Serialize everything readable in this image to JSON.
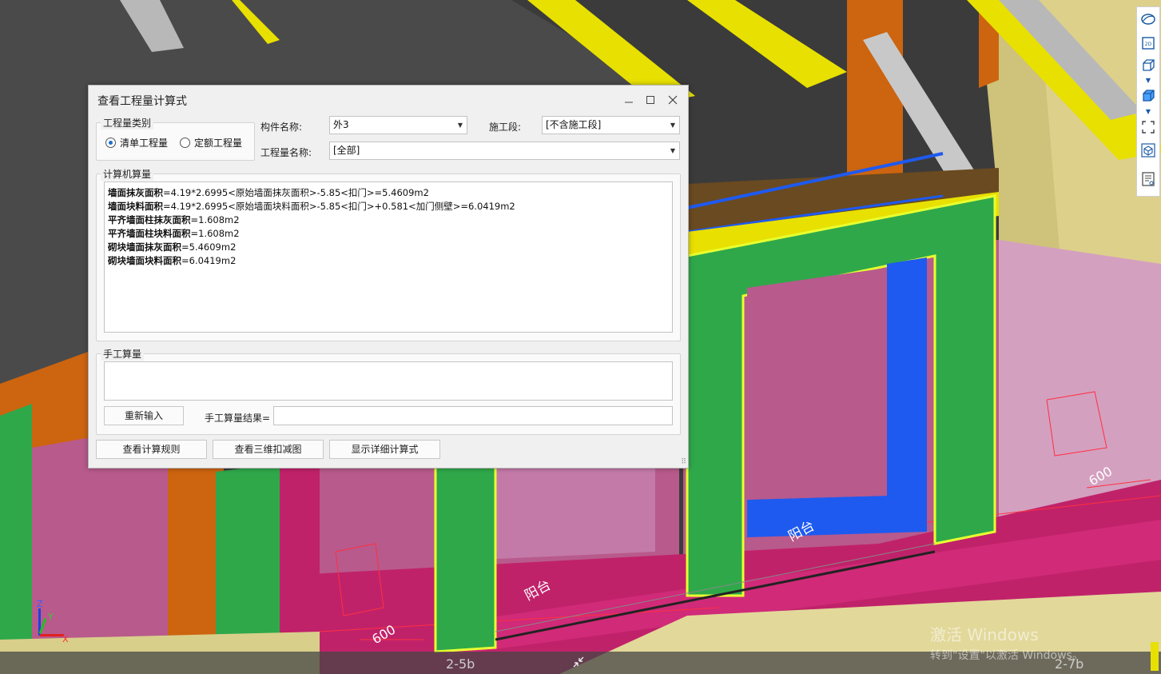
{
  "dialog": {
    "title": "查看工程量计算式",
    "quantity_type": {
      "legend": "工程量类别",
      "options": [
        "清单工程量",
        "定额工程量"
      ],
      "selected": "清单工程量"
    },
    "component_name": {
      "label": "构件名称:",
      "value": "外3"
    },
    "construction_stage": {
      "label": "施工段:",
      "value": "[不含施工段]"
    },
    "quantity_name": {
      "label": "工程量名称:",
      "value": "[全部]"
    },
    "computer_calc": {
      "legend": "计算机算量",
      "lines": [
        {
          "name": "墙面抹灰面积",
          "formula": "=4.19*2.6995<原始墙面抹灰面积>-5.85<扣门>=5.4609m2"
        },
        {
          "name": "墙面块料面积",
          "formula": "=4.19*2.6995<原始墙面块料面积>-5.85<扣门>+0.581<加门侧壁>=6.0419m2"
        },
        {
          "name": "平齐墙面柱抹灰面积",
          "formula": "=1.608m2"
        },
        {
          "name": "平齐墙面柱块料面积",
          "formula": "=1.608m2"
        },
        {
          "name": "砌块墙面抹灰面积",
          "formula": "=5.4609m2"
        },
        {
          "name": "砌块墙面块料面积",
          "formula": "=6.0419m2"
        }
      ]
    },
    "manual_calc": {
      "legend": "手工算量",
      "reenter_button": "重新输入",
      "result_label": "手工算量结果=",
      "result_value": ""
    },
    "buttons": {
      "view_rules": "查看计算规则",
      "view_3d": "查看三维扣减图",
      "show_detail": "显示详细计算式"
    }
  },
  "viewport": {
    "labels": [
      "阳台",
      "阳台",
      "600",
      "600"
    ],
    "axis": {
      "x": "X",
      "y": "Y",
      "z": "Z"
    },
    "grid_labels": [
      "2-5b",
      "2-7b"
    ]
  },
  "toolbar": {
    "icons": [
      "orbit-icon",
      "2d-icon",
      "cube-view-icon",
      "cube-solid-icon",
      "fullscreen-icon",
      "3d-box-icon",
      "list-view-icon"
    ],
    "label_2d": "2D"
  },
  "watermark": {
    "line1": "激活 Windows",
    "line2": "转到\"设置\"以激活 Windows。"
  },
  "colors": {
    "green_wall": "#2fa84a",
    "magenta_floor": "#c0226a",
    "pink_wall": "#b85a8c",
    "yellow_beam": "#e8e000",
    "orange_beam": "#cc6410",
    "blue_frame": "#1e5af0",
    "red_arrow": "#e83030"
  }
}
